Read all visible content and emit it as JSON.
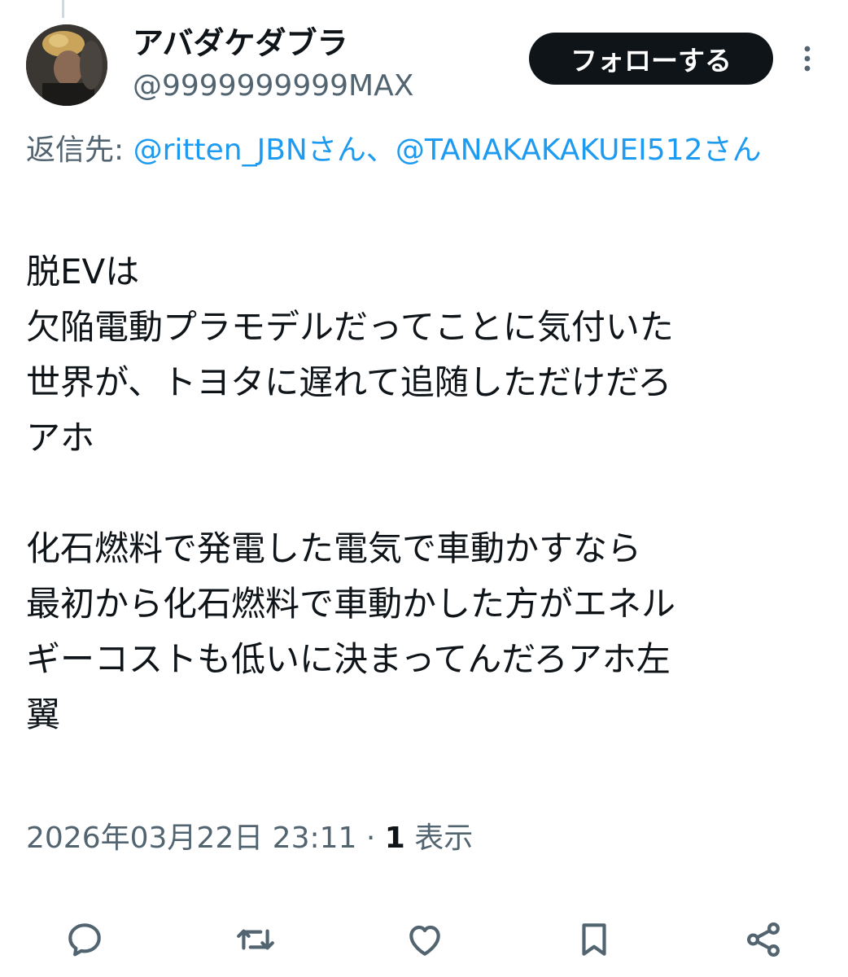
{
  "author": {
    "display_name": "アバダケダブラ",
    "handle": "@9999999999MAX"
  },
  "follow_button_label": "フォローする",
  "reply_to": {
    "prefix": "返信先: ",
    "mention_1": "@ritten_JBNさん",
    "separator": "、",
    "mention_2": "@TANAKAKAKUEI512さん"
  },
  "tweet_text": "脱EVは\n欠陥電動プラモデルだってことに気付いた\n世界が、トヨタに遅れて追随しただけだろ\nアホ\n\n化石燃料で発電した電気で車動かすなら\n最初から化石燃料で車動かした方がエネル\nギーコストも低いに決まってんだろアホ左\n翼",
  "meta": {
    "timestamp": "2026年03月22日 23:11",
    "separator": " · ",
    "views_count": "1",
    "views_label": " 表示"
  },
  "actions": {
    "reply_icon": "reply-icon",
    "repost_icon": "repost-icon",
    "like_icon": "like-icon",
    "bookmark_icon": "bookmark-icon",
    "share_icon": "share-icon"
  },
  "colors": {
    "text_primary": "#0f1419",
    "text_secondary": "#536471",
    "link": "#1d9bf0",
    "button_bg": "#0f1419"
  }
}
